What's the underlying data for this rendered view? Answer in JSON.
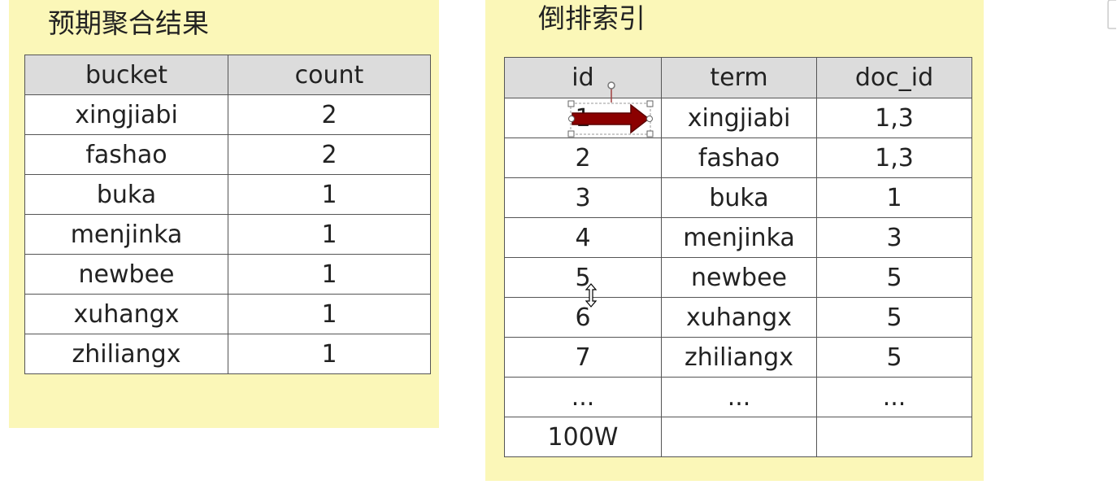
{
  "left_panel": {
    "title": "预期聚合结果",
    "headers": [
      "bucket",
      "count"
    ],
    "rows": [
      [
        "xingjiabi",
        "2"
      ],
      [
        "fashao",
        "2"
      ],
      [
        "buka",
        "1"
      ],
      [
        "menjinka",
        "1"
      ],
      [
        "newbee",
        "1"
      ],
      [
        "xuhangx",
        "1"
      ],
      [
        "zhiliangx",
        "1"
      ]
    ]
  },
  "right_panel": {
    "title": "倒排索引",
    "headers": [
      "id",
      "term",
      "doc_id"
    ],
    "rows": [
      [
        "1",
        "xingjiabi",
        "1,3"
      ],
      [
        "2",
        "fashao",
        "1,3"
      ],
      [
        "3",
        "buka",
        "1"
      ],
      [
        "4",
        "menjinka",
        "3"
      ],
      [
        "5",
        "newbee",
        "5"
      ],
      [
        "6",
        "xuhangx",
        "5"
      ],
      [
        "7",
        "zhiliangx",
        "5"
      ],
      [
        "...",
        "...",
        "..."
      ],
      [
        "100W",
        "",
        ""
      ]
    ]
  },
  "colors": {
    "panel_background": "#fbf7b8",
    "header_background": "#dcdcdc",
    "arrow": "#8b0000"
  },
  "icons": {
    "arrow_shape": "right-arrow-icon",
    "cursor": "vertical-resize-cursor-icon"
  }
}
